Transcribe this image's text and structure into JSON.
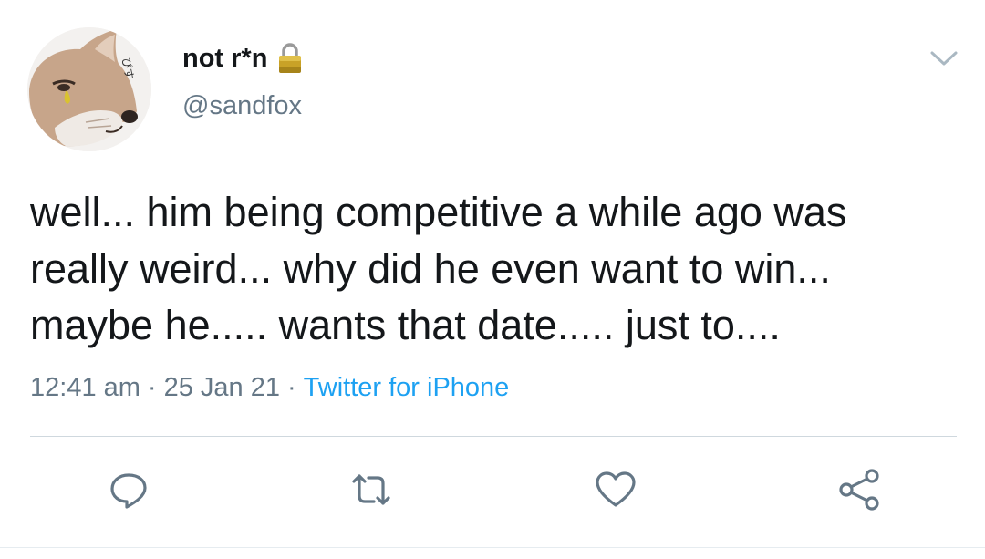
{
  "user": {
    "display_name": "not r*n",
    "handle": "@sandfox",
    "avatar_icon": "fox-avatar",
    "lock_icon": "lock-icon"
  },
  "tweet": {
    "text": "well... him being competitive a while ago was\nreally weird... why did he even want to win...\nmaybe he..... wants that date..... just to....",
    "time": "12:41 am",
    "date": "25 Jan 21",
    "separator": "·",
    "source": "Twitter for iPhone"
  },
  "actions": [
    {
      "name": "reply",
      "icon": "reply-icon"
    },
    {
      "name": "retweet",
      "icon": "retweet-icon"
    },
    {
      "name": "like",
      "icon": "heart-icon"
    },
    {
      "name": "share",
      "icon": "share-icon"
    }
  ],
  "colors": {
    "text": "#14171a",
    "secondary": "#657786",
    "link": "#1da1f2",
    "icon": "#657786"
  }
}
